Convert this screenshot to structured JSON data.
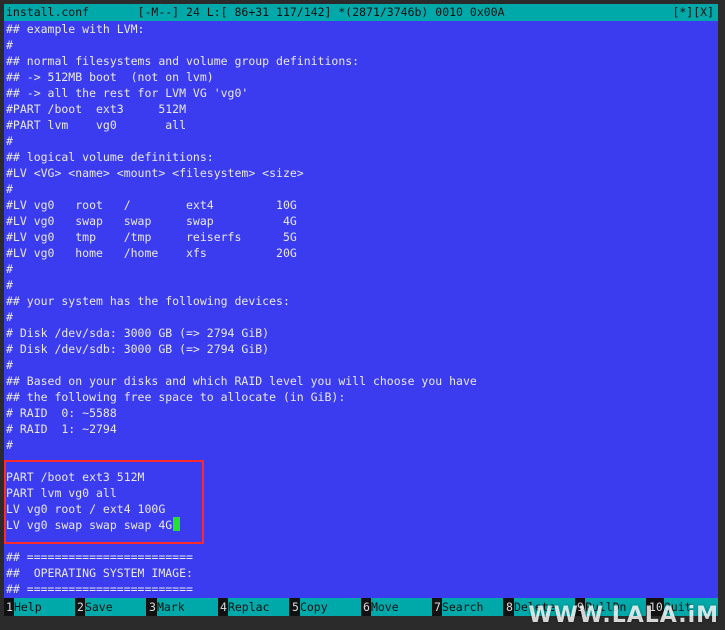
{
  "status_bar": {
    "filename": "install.conf",
    "info": "[-M--] 24 L:[ 86+31 117/142] *(2871/3746b) 0010 0x00A",
    "flags": "[*][X]"
  },
  "editor": {
    "lines": [
      "## example with LVM:",
      "#",
      "## normal filesystems and volume group definitions:",
      "## -> 512MB boot  (not on lvm)",
      "## -> all the rest for LVM VG 'vg0'",
      "#PART /boot  ext3     512M",
      "#PART lvm    vg0       all",
      "#",
      "## logical volume definitions:",
      "#LV <VG> <name> <mount> <filesystem> <size>",
      "#",
      "#LV vg0   root   /        ext4         10G",
      "#LV vg0   swap   swap     swap          4G",
      "#LV vg0   tmp    /tmp     reiserfs      5G",
      "#LV vg0   home   /home    xfs          20G",
      "#",
      "#",
      "## your system has the following devices:",
      "#",
      "# Disk /dev/sda: 3000 GB (=> 2794 GiB)",
      "# Disk /dev/sdb: 3000 GB (=> 2794 GiB)",
      "#",
      "## Based on your disks and which RAID level you will choose you have",
      "## the following free space to allocate (in GiB):",
      "# RAID  0: ~5588",
      "# RAID  1: ~2794",
      "#",
      "",
      "PART /boot ext3 512M",
      "PART lvm vg0 all",
      "LV vg0 root / ext4 100G",
      "LV vg0 swap swap swap 4G",
      "",
      "## ========================",
      "##  OPERATING SYSTEM IMAGE:",
      "## ========================"
    ]
  },
  "function_keys": [
    {
      "num": "1",
      "label": "Help"
    },
    {
      "num": "2",
      "label": "Save"
    },
    {
      "num": "3",
      "label": "Mark"
    },
    {
      "num": "4",
      "label": "Replac"
    },
    {
      "num": "5",
      "label": "Copy"
    },
    {
      "num": "6",
      "label": "Move"
    },
    {
      "num": "7",
      "label": "Search"
    },
    {
      "num": "8",
      "label": "Delete"
    },
    {
      "num": "9",
      "label": "PullDn"
    },
    {
      "num": "10",
      "label": "Quit"
    }
  ],
  "watermark": "WWW.LALA.iM",
  "colors": {
    "background": "#3b3bf0",
    "status_bar": "#00a9a9",
    "cursor": "#22e22e",
    "highlight_box": "#ff2b2b"
  }
}
